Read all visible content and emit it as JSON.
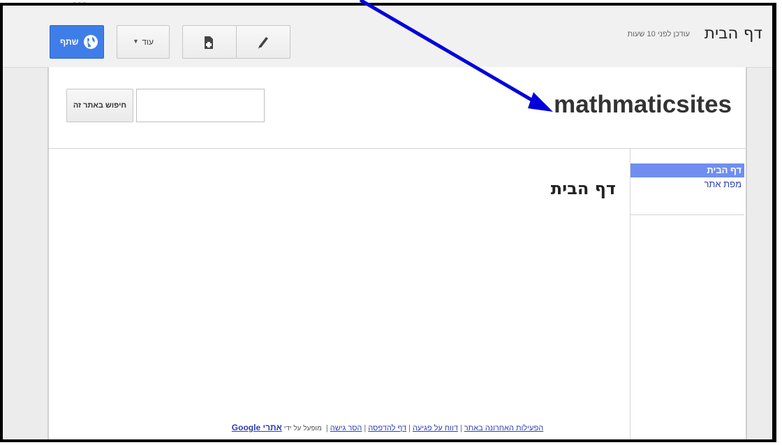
{
  "topbar": {
    "page_title": "דף הבית",
    "updated_text": "עודכן לפני 10 שעות",
    "edit_icon": "pencil-icon",
    "new_page_icon": "new-page-icon",
    "more_label": "עוד",
    "more_caret": "▼",
    "share_label": "שתף",
    "share_icon": "globe-icon"
  },
  "site": {
    "name": "mathmaticsites",
    "search_placeholder": "",
    "search_button_label": "חיפוש באתר זה",
    "main_title": "דף הבית"
  },
  "sidebar": {
    "items": [
      {
        "label": "דף הבית",
        "selected": true
      },
      {
        "label": "מפת אתר",
        "selected": false
      }
    ]
  },
  "footer": {
    "links": [
      {
        "label": "הפעילות האחרונה באתר"
      },
      {
        "label": "דווח על פגיעה"
      },
      {
        "label": "דף להדפסה"
      },
      {
        "label": "הסר גישה"
      }
    ],
    "separator": "|",
    "powered_by": "מופעל על ידי",
    "sites_link": "אתרי Google"
  },
  "annotation": {
    "arrow_color": "#0000dd"
  },
  "colors": {
    "share_button": "#3f7de8",
    "nav_selected": "#6f8ef0",
    "link": "#2a3fb3"
  }
}
